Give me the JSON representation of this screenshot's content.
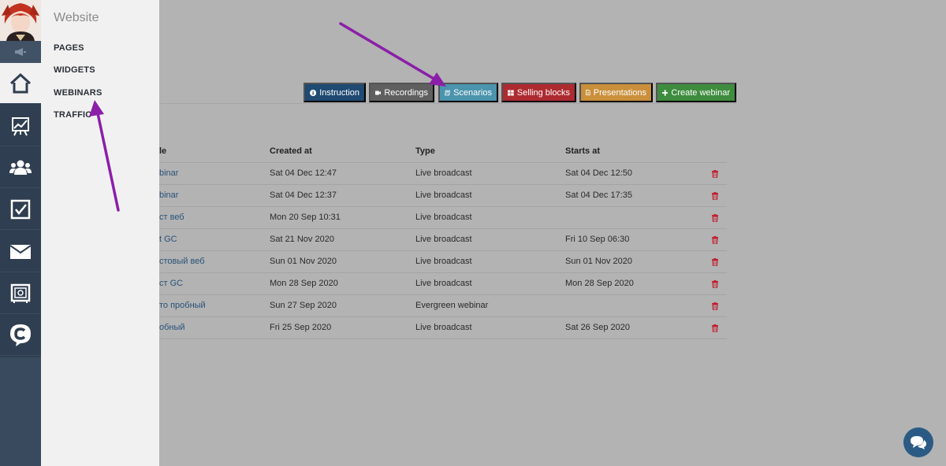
{
  "flyout": {
    "title": "Website",
    "items": [
      "PAGES",
      "WIDGETS",
      "WEBINARS",
      "TRAFFIC"
    ]
  },
  "rail": {
    "icons": [
      "home-icon",
      "chart-icon",
      "users-icon",
      "checkbox-icon",
      "mail-icon",
      "safe-icon",
      "brand-c-icon"
    ],
    "active": "home-icon"
  },
  "toolbar": {
    "instruction": "Instruction",
    "recordings": "Recordings",
    "scenarios": "Scenarios",
    "selling_blocks": "Selling blocks",
    "presentations": "Presentations",
    "create_webinar": "Create webinar"
  },
  "table": {
    "headers": [
      "le",
      "Created at",
      "Type",
      "Starts at"
    ],
    "rows": [
      {
        "name": "binar",
        "created": "Sat 04 Dec 12:47",
        "type": "Live broadcast",
        "starts": "Sat 04 Dec 12:50"
      },
      {
        "name": "binar",
        "created": "Sat 04 Dec 12:37",
        "type": "Live broadcast",
        "starts": "Sat 04 Dec 17:35"
      },
      {
        "name": "ст веб",
        "created": "Mon 20 Sep 10:31",
        "type": "Live broadcast",
        "starts": ""
      },
      {
        "name": "t GC",
        "created": "Sat 21 Nov 2020",
        "type": "Live broadcast",
        "starts": "Fri 10 Sep 06:30"
      },
      {
        "name": "стовый веб",
        "created": "Sun 01 Nov 2020",
        "type": "Live broadcast",
        "starts": "Sun 01 Nov 2020"
      },
      {
        "name": "ст GC",
        "created": "Mon 28 Sep 2020",
        "type": "Live broadcast",
        "starts": "Mon 28 Sep 2020"
      },
      {
        "name": "то пробный",
        "created": "Sun 27 Sep 2020",
        "type": "Evergreen webinar",
        "starts": ""
      },
      {
        "name": "обный",
        "created": "Fri 25 Sep 2020",
        "type": "Live broadcast",
        "starts": "Sat 26 Sep 2020"
      }
    ]
  },
  "colors": {
    "overlay": "#b3b3b3",
    "rail": "#2f3e50",
    "arrow": "#8b1fa8",
    "delete": "#c0202f"
  }
}
